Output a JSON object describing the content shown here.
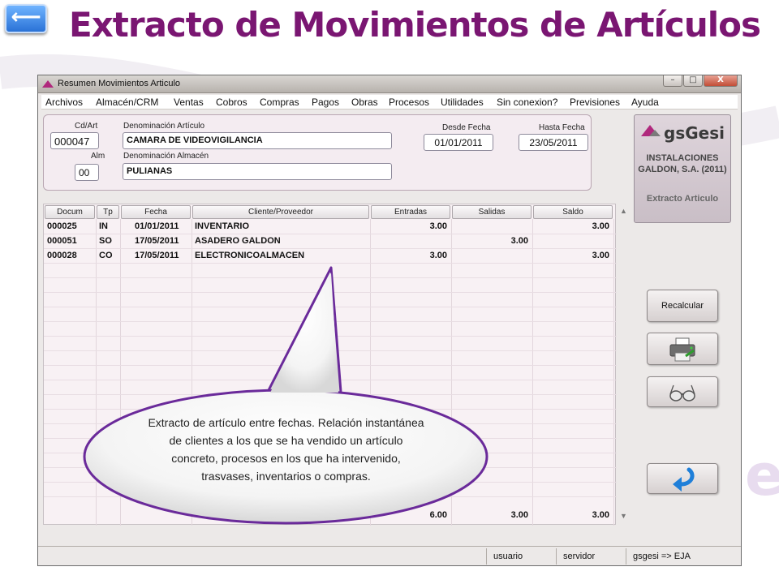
{
  "slide": {
    "title": "Extracto de Movimientos de Artículos",
    "back_label": "⟵",
    "accent": "#7a1672"
  },
  "window": {
    "title": "Resumen Movimientos Articulo",
    "controls": {
      "close": "X"
    }
  },
  "menu": [
    "Archivos",
    "Almacén/CRM",
    "Ventas",
    "Cobros",
    "Compras",
    "Pagos",
    "Obras",
    "Procesos",
    "Utilidades",
    "Sin conexion?",
    "Previsiones",
    "Ayuda"
  ],
  "filters": {
    "cd_art_label": "Cd/Art",
    "cd_art_value": "000047",
    "denominacion_label": "Denominación Artículo",
    "denominacion_value": "CAMARA DE VIDEOVIGILANCIA",
    "alm_label": "Alm",
    "alm_value": "00",
    "almacen_label": "Denominación Almacén",
    "almacen_value": "PULIANAS",
    "desde_label": "Desde Fecha",
    "desde_value": "01/01/2011",
    "hasta_label": "Hasta Fecha",
    "hasta_value": "23/05/2011"
  },
  "brand": {
    "name": "gsGesi",
    "company": "INSTALACIONES GALDON, S.A. (2011)",
    "subtitle": "Extracto Articulo"
  },
  "table": {
    "headers": [
      "Docum",
      "Tp",
      "Fecha",
      "Cliente/Proveedor",
      "Entradas",
      "Salidas",
      "Saldo"
    ],
    "rows": [
      [
        "000025",
        "IN",
        "01/01/2011",
        "INVENTARIO",
        "3.00",
        "",
        "3.00"
      ],
      [
        "000051",
        "SO",
        "17/05/2011",
        "ASADERO GALDON",
        "",
        "3.00",
        ""
      ],
      [
        "000028",
        "CO",
        "17/05/2011",
        "ELECTRONICOALMACEN",
        "3.00",
        "",
        "3.00"
      ]
    ],
    "totals": {
      "entradas": "6.00",
      "salidas": "3.00",
      "saldo": "3.00"
    }
  },
  "buttons": {
    "recalcular": "Recalcular",
    "print_icon": "printer-icon",
    "view_icon": "glasses-icon",
    "exit_icon": "return-arrow-icon"
  },
  "status": {
    "usuario": "usuario",
    "servidor": "servidor",
    "conexion": "gsgesi => EJA"
  },
  "callout": {
    "text": "Extracto de artículo entre fechas. Relación instantánea de clientes  a los que se ha vendido un artículo concreto, procesos en los que ha intervenido, trasvases, inventarios o compras."
  }
}
